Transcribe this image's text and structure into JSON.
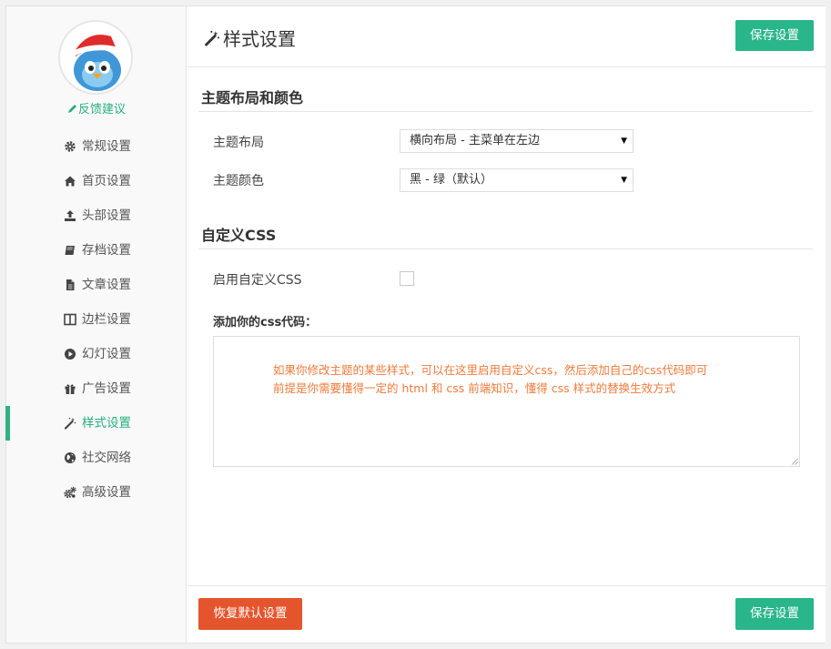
{
  "sidebar": {
    "feedback_label": "反馈建议",
    "items": [
      {
        "label": "常规设置",
        "icon": "gear-icon"
      },
      {
        "label": "首页设置",
        "icon": "home-icon"
      },
      {
        "label": "头部设置",
        "icon": "upload-icon"
      },
      {
        "label": "存档设置",
        "icon": "book-icon"
      },
      {
        "label": "文章设置",
        "icon": "file-icon"
      },
      {
        "label": "边栏设置",
        "icon": "columns-icon"
      },
      {
        "label": "幻灯设置",
        "icon": "play-circle-icon"
      },
      {
        "label": "广告设置",
        "icon": "gift-icon"
      },
      {
        "label": "样式设置",
        "icon": "magic-wand-icon",
        "active": true
      },
      {
        "label": "社交网络",
        "icon": "globe-icon"
      },
      {
        "label": "高级设置",
        "icon": "gears-icon"
      }
    ]
  },
  "header": {
    "title": "样式设置",
    "title_icon": "magic-wand-icon",
    "save_label": "保存设置"
  },
  "layout_section": {
    "title": "主题布局和颜色",
    "layout_label": "主题布局",
    "layout_value": "横向布局 - 主菜单在左边",
    "color_label": "主题颜色",
    "color_value": "黑 - 绿（默认）"
  },
  "css_section": {
    "title": "自定义CSS",
    "enable_label": "启用自定义CSS",
    "enable_checked": false,
    "code_label": "添加你的css代码：",
    "placeholder_line1": "如果你修改主题的某些样式，可以在这里启用自定义css，然后添加自己的css代码即可",
    "placeholder_line2": "前提是你需要懂得一定的 html 和 css 前端知识，懂得 css 样式的替换生效方式"
  },
  "footer": {
    "reset_label": "恢复默认设置",
    "save_label": "保存设置"
  },
  "colors": {
    "accent_green": "#28b68a",
    "reset_orange": "#e5552d",
    "hint_orange": "#f07a3a"
  }
}
